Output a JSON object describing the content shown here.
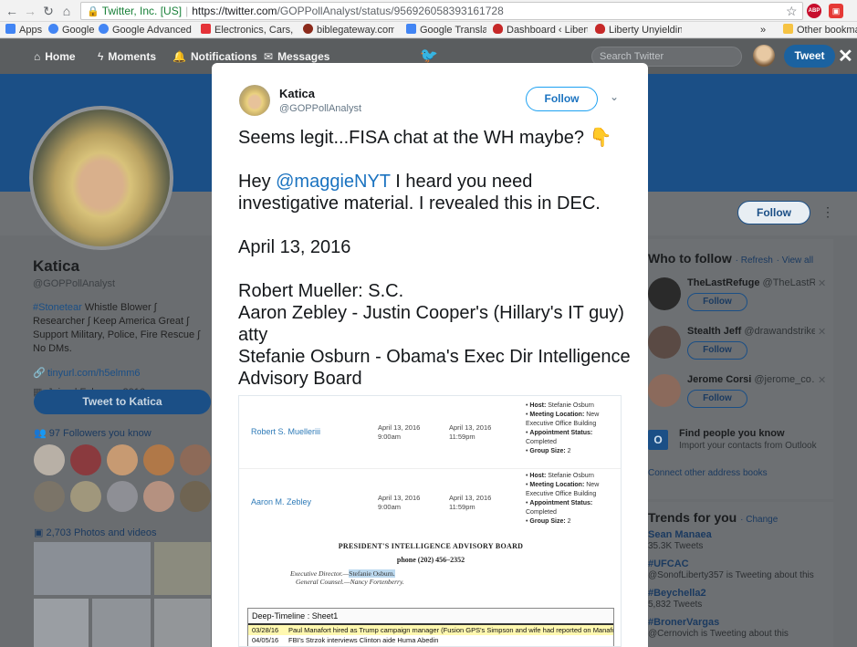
{
  "browser": {
    "secure_label": "Twitter, Inc. [US]",
    "url_host": "https://twitter.com",
    "url_path": "/GOPPollAnalyst/status/956926058393161728",
    "bookmarks": [
      {
        "label": "Apps",
        "color": "#4285f4"
      },
      {
        "label": "Google",
        "color": "#4285f4"
      },
      {
        "label": "Google Advanced Se",
        "color": "#4285f4"
      },
      {
        "label": "Electronics, Cars, Fas",
        "color": "#e53238"
      },
      {
        "label": "biblegateway.com A",
        "color": "#8b2a1b"
      },
      {
        "label": "Google Translate",
        "color": "#4285f4"
      },
      {
        "label": "Dashboard ‹ Liberty U",
        "color": "#c62828"
      },
      {
        "label": "Liberty Unyielding",
        "color": "#c62828"
      },
      {
        "label": "»",
        "color": ""
      },
      {
        "label": "Other bookmarks",
        "color": "#f6c343"
      }
    ]
  },
  "twitter_nav": {
    "home": "Home",
    "moments": "Moments",
    "notifications": "Notifications",
    "messages": "Messages",
    "search_placeholder": "Search Twitter",
    "tweet_button": "Tweet"
  },
  "profile": {
    "name": "Katica",
    "handle": "@GOPPollAnalyst",
    "bio_tag": "#Stonetear",
    "bio_rest": " Whistle Blower ∫ Researcher ∫ Keep America Great ∫ Support Military, Police, Fire Rescue ∫ No DMs.",
    "link": "tinyurl.com/h5elmm6",
    "joined": "Joined February 2016",
    "tweet_to": "Tweet to Katica",
    "followers_you_know": "97 Followers you know",
    "photos_videos": "2,703 Photos and videos",
    "follow_button": "Follow"
  },
  "who_to_follow": {
    "title": "Who to follow",
    "refresh": "· Refresh",
    "view_all": "· View all",
    "items": [
      {
        "name": "TheLastRefuge",
        "handle": "@TheLastR…",
        "follow": "Follow"
      },
      {
        "name": "Stealth Jeff",
        "handle": "@drawandstrike",
        "follow": "Follow"
      },
      {
        "name": "Jerome Corsi",
        "handle": "@jerome_co…",
        "follow": "Follow"
      }
    ],
    "find_people_title": "Find people you know",
    "find_people_sub": "Import your contacts from Outlook",
    "connect": "Connect other address books"
  },
  "trends": {
    "title": "Trends for you",
    "change": "· Change",
    "items": [
      {
        "name": "Sean Manaea",
        "sub": "35.3K Tweets"
      },
      {
        "name": "#UFCAC",
        "sub": "@SonofLiberty357 is Tweeting about this"
      },
      {
        "name": "#Beychella2",
        "sub": "5,832 Tweets"
      },
      {
        "name": "#BronerVargas",
        "sub": "@Cernovich is Tweeting about this"
      }
    ]
  },
  "tweet": {
    "author_name": "Katica",
    "author_handle": "@GOPPollAnalyst",
    "follow_button": "Follow",
    "line1": "Seems legit...FISA chat at the WH maybe? 👇",
    "line2_pre": "Hey ",
    "line2_mention": "@maggieNYT",
    "line2_post": " I heard you need investigative material. I revealed this in DEC.",
    "date_line": "April 13, 2016",
    "line_mueller": "Robert Mueller: S.C.",
    "line_zebley": "Aaron Zebley - Justin Cooper's (Hillary's IT guy) atty",
    "line_osburn": "Stefanie Osburn - Obama's Exec Dir Intelligence Advisory Board"
  },
  "tweet_image": {
    "meetings": [
      {
        "name": "Robert S. Muelleriii",
        "start_date": "April 13, 2016",
        "start_time": "9:00am",
        "end_date": "April 13, 2016",
        "end_time": "11:59pm",
        "host": "Stefanie Osburn",
        "location": "New Executive Office Building",
        "status": "Completed",
        "group_size": "2"
      },
      {
        "name": "Aaron M. Zebley",
        "start_date": "April 13, 2016",
        "start_time": "9:00am",
        "end_date": "April 13, 2016",
        "end_time": "11:59pm",
        "host": "Stefanie Osburn",
        "location": "New Executive Office Building",
        "status": "Completed",
        "group_size": "2"
      }
    ],
    "labels": {
      "host": "Host:",
      "location": "Meeting Location:",
      "status": "Appointment Status:",
      "group": "Group Size:"
    },
    "board_title": "PRESIDENT'S INTELLIGENCE ADVISORY BOARD",
    "board_phone": "phone (202) 456–2352",
    "exec_dir_label": "Executive Director.—",
    "exec_dir_name": "Stefanie Osburn.",
    "counsel": "General Counsel.—Nancy Fortenberry.",
    "sheet_title": "Deep-Timeline : Sheet1",
    "sheet_rows": [
      {
        "date": "03/28/16",
        "text": "Paul Manafort hired as Trump campaign manager (Fusion GPS's Simpson and wife had reported on Manafort"
      },
      {
        "date": "04/05/16",
        "text": "FBI's Strzok interviews Clinton aide Huma Abedin"
      }
    ]
  }
}
